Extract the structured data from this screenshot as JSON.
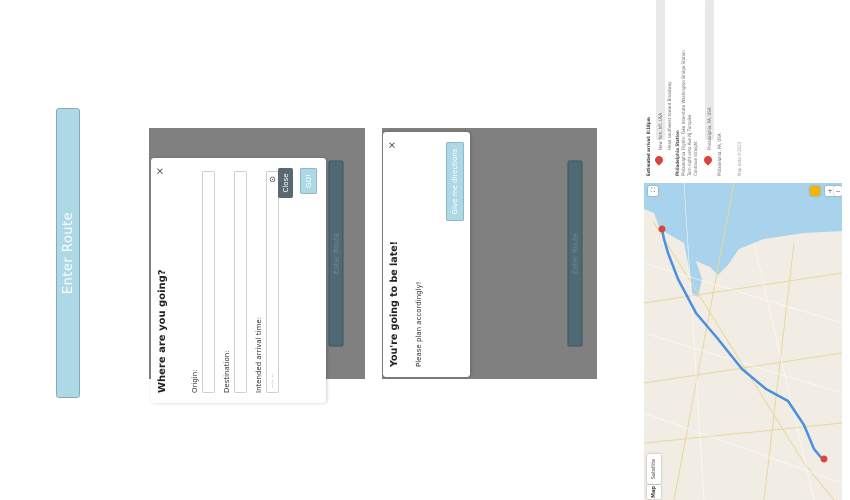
{
  "panel1": {
    "enter_route_label": "Enter Route"
  },
  "route_modal": {
    "title": "Where are you going?",
    "origin_label": "Origin:",
    "destination_label": "Destination:",
    "arrival_label": "Intended arrival time:",
    "arrival_placeholder": "--:-- --",
    "go_label": "GO!",
    "close_label": "Close",
    "close_icon": "×",
    "underlying_button_label": "Enter Route"
  },
  "late_modal": {
    "title": "You're going to be late!",
    "body": "Please plan accordingly!",
    "directions_button": "Give me directions",
    "close_icon": "×",
    "underlying_button_label": "Enter Route"
  },
  "directions": {
    "summary": "Estimated arrival: 8:18pm",
    "origin": "New York, NY, USA",
    "steps": [
      "Head southwest toward Broadway",
      "Philadelphia Flights: Take Interstate Washington Bridge Station",
      "Turn right onto Ave NJ Turnpike",
      "Continue straight",
      "Philadelphia, PA, USA"
    ],
    "transit_heading": "Philadelphia Station",
    "destination": "Philadelphia, PA, USA",
    "footer": "Map data ©2023"
  },
  "map": {
    "mode_map": "Map",
    "mode_satellite": "Satellite",
    "zoom_in": "+",
    "zoom_out": "−",
    "colors": {
      "water": "#a9d3ec",
      "land": "#f1ede4",
      "route": "#4a8fe0",
      "pin": "#d9453a"
    }
  }
}
